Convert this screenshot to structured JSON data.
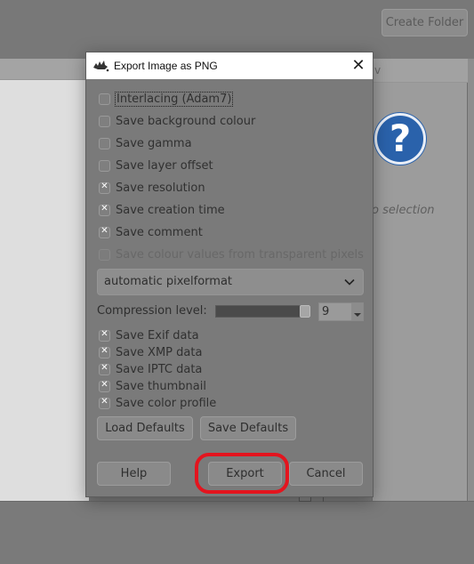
{
  "background": {
    "create_folder_label": "Create Folder",
    "right_header_fragment": "v",
    "no_selection_text": "o selection",
    "help_icon_glyph": "?"
  },
  "dialog": {
    "title": "Export Image as PNG",
    "close_glyph": "✕",
    "options": [
      {
        "label": "Interlacing (Adam7)",
        "checked": false,
        "disabled": false,
        "focused": true
      },
      {
        "label": "Save background colour",
        "checked": false,
        "disabled": false
      },
      {
        "label": "Save gamma",
        "checked": false,
        "disabled": false
      },
      {
        "label": "Save layer offset",
        "checked": false,
        "disabled": false
      },
      {
        "label": "Save resolution",
        "checked": true,
        "disabled": false
      },
      {
        "label": "Save creation time",
        "checked": true,
        "disabled": false
      },
      {
        "label": "Save comment",
        "checked": true,
        "disabled": false
      },
      {
        "label": "Save colour values from transparent pixels",
        "checked": false,
        "disabled": true
      }
    ],
    "pixelformat": {
      "selected": "automatic pixelformat"
    },
    "compression": {
      "label": "Compression level:",
      "value": "9",
      "min": 0,
      "max": 9
    },
    "metadata_options": [
      {
        "label": "Save Exif data",
        "checked": true
      },
      {
        "label": "Save XMP data",
        "checked": true
      },
      {
        "label": "Save IPTC data",
        "checked": true
      },
      {
        "label": "Save thumbnail",
        "checked": true
      },
      {
        "label": "Save color profile",
        "checked": true
      }
    ],
    "buttons": {
      "load_defaults": "Load Defaults",
      "save_defaults": "Save Defaults",
      "help": "Help",
      "export": "Export",
      "cancel": "Cancel"
    },
    "annotation": {
      "highlighted_button": "export",
      "color": "#e4141e"
    }
  }
}
